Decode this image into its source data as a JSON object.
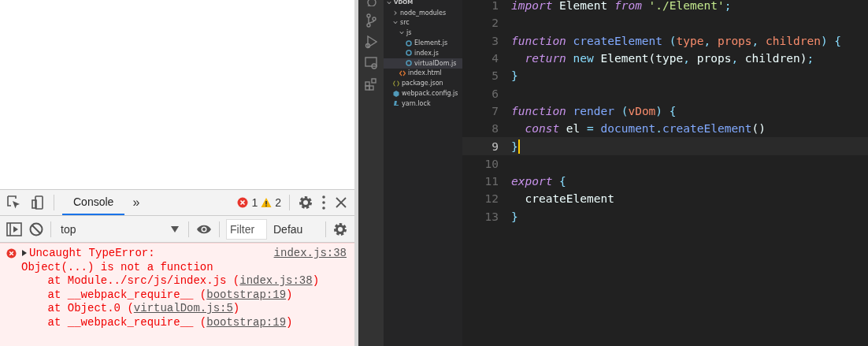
{
  "devtools": {
    "tabs": [
      {
        "label": "Console",
        "selected": true
      }
    ],
    "more": "»",
    "errors": "1",
    "warnings": "2",
    "console_toolbar": {
      "context": "top",
      "filter": {
        "placeholder": "Filter"
      },
      "levels": "Defau"
    },
    "messages": [
      {
        "kind": "error",
        "expanded": false,
        "title": "Uncaught TypeError:",
        "source": "index.js:38",
        "detail": "Object(...) is not a function",
        "frames": [
          {
            "at": "at Module../src/js/index.js (",
            "link": "index.js:38",
            "end": ")"
          },
          {
            "at": "at __webpack_require__ (",
            "link": "bootstrap:19",
            "end": ")"
          },
          {
            "at": "at Object.0 (",
            "link": "virtualDom.js:5",
            "end": ")"
          },
          {
            "at": "at __webpack_require__ (",
            "link": "bootstrap:19",
            "end": ")"
          }
        ]
      }
    ]
  },
  "explorer": {
    "root": {
      "label": "VDOM",
      "kind": "folder",
      "expanded": true,
      "children": [
        {
          "label": "node_modules",
          "kind": "folder",
          "expanded": false
        },
        {
          "label": "src",
          "kind": "folder",
          "expanded": true,
          "children": [
            {
              "label": "js",
              "kind": "folder",
              "expanded": true,
              "children": [
                {
                  "label": "Element.js",
                  "kind": "js",
                  "selected": false
                },
                {
                  "label": "index.js",
                  "kind": "js",
                  "selected": false
                },
                {
                  "label": "virtualDom.js",
                  "kind": "js",
                  "selected": true
                }
              ]
            },
            {
              "label": "index.html",
              "kind": "html",
              "selected": false
            }
          ]
        },
        {
          "label": "package.json",
          "kind": "json",
          "selected": false
        },
        {
          "label": "webpack.config.js",
          "kind": "webpack",
          "selected": false
        },
        {
          "label": "yarn.lock",
          "kind": "yarn",
          "selected": false
        }
      ]
    }
  },
  "editor": {
    "lines": [
      {
        "number": "1",
        "current": false,
        "tokens": [
          {
            "kind": "keyword",
            "text": "import"
          },
          {
            "kind": "plain",
            "text": " Element "
          },
          {
            "kind": "keyword",
            "text": "from"
          },
          {
            "kind": "string",
            "text": " './Element'"
          },
          {
            "kind": "punct",
            "text": ";"
          }
        ]
      },
      {
        "number": "2",
        "current": false
      },
      {
        "number": "3",
        "current": false,
        "tokens": [
          {
            "kind": "keyword",
            "text": "function"
          },
          {
            "kind": "function",
            "text": " createElement"
          },
          {
            "kind": "punct",
            "text": " ("
          },
          {
            "kind": "param",
            "text": "type"
          },
          {
            "kind": "punct",
            "text": ", "
          },
          {
            "kind": "param",
            "text": "props"
          },
          {
            "kind": "punct",
            "text": ", "
          },
          {
            "kind": "param",
            "text": "children"
          },
          {
            "kind": "punct",
            "text": ") {"
          }
        ]
      },
      {
        "number": "4",
        "current": false,
        "tokens": [
          {
            "kind": "keyword",
            "text": "  return"
          },
          {
            "kind": "operator",
            "text": " new"
          },
          {
            "kind": "plain",
            "text": " Element(type"
          },
          {
            "kind": "punct",
            "text": ","
          },
          {
            "kind": "plain",
            "text": " props"
          },
          {
            "kind": "punct",
            "text": ","
          },
          {
            "kind": "plain",
            "text": " children)"
          },
          {
            "kind": "punct",
            "text": ";"
          }
        ]
      },
      {
        "number": "5",
        "current": false,
        "tokens": [
          {
            "kind": "punct",
            "text": "}"
          }
        ]
      },
      {
        "number": "6",
        "current": false
      },
      {
        "number": "7",
        "current": false,
        "tokens": [
          {
            "kind": "keyword",
            "text": "function"
          },
          {
            "kind": "function",
            "text": " render"
          },
          {
            "kind": "punct",
            "text": " ("
          },
          {
            "kind": "param",
            "text": "vDom"
          },
          {
            "kind": "punct",
            "text": ") {"
          }
        ]
      },
      {
        "number": "8",
        "current": false,
        "tokens": [
          {
            "kind": "keyword",
            "text": "  const"
          },
          {
            "kind": "plain",
            "text": " el "
          },
          {
            "kind": "punct",
            "text": "="
          },
          {
            "kind": "function",
            "text": " document"
          },
          {
            "kind": "punct",
            "text": "."
          },
          {
            "kind": "function",
            "text": "createElement"
          },
          {
            "kind": "plain",
            "text": "()"
          }
        ]
      },
      {
        "number": "9",
        "current": true,
        "tokens": [
          {
            "kind": "punct",
            "text": "}"
          }
        ]
      },
      {
        "number": "10",
        "current": false
      },
      {
        "number": "11",
        "current": false,
        "tokens": [
          {
            "kind": "keyword",
            "text": "export"
          },
          {
            "kind": "punct",
            "text": " {"
          }
        ]
      },
      {
        "number": "12",
        "current": false,
        "tokens": [
          {
            "kind": "plain",
            "text": "  createElement"
          }
        ]
      },
      {
        "number": "13",
        "current": false,
        "tokens": [
          {
            "kind": "punct",
            "text": "}"
          }
        ]
      }
    ]
  }
}
